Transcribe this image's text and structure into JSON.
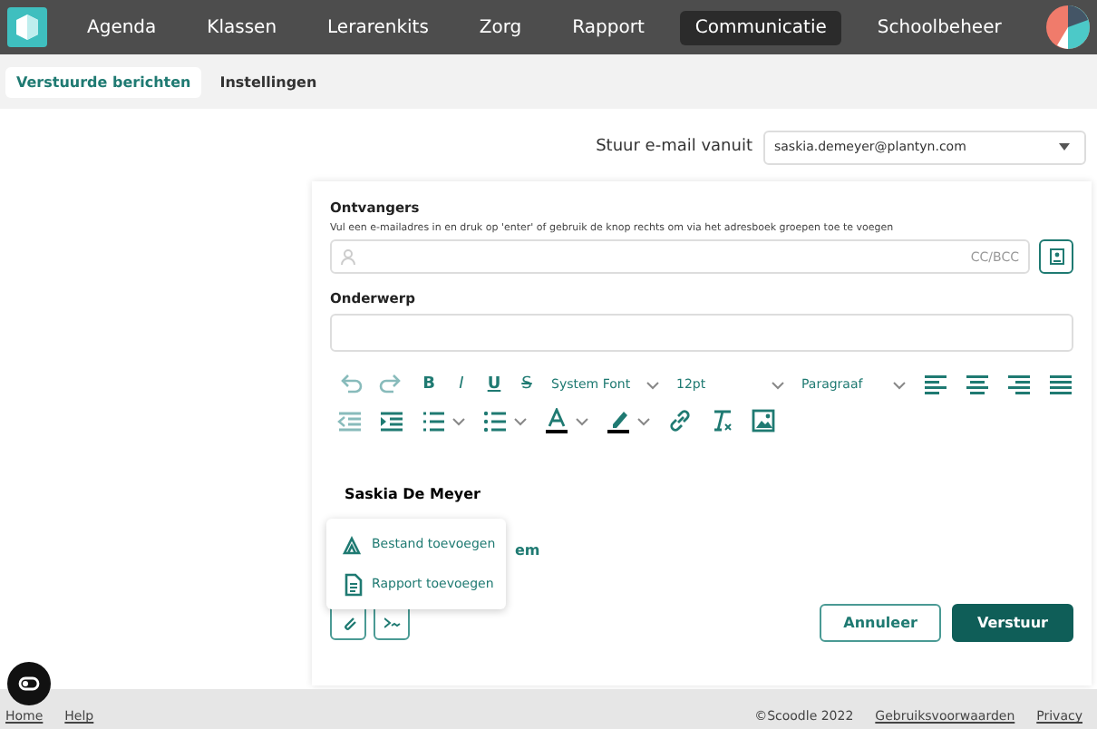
{
  "nav": [
    {
      "label": "Agenda",
      "selected": false
    },
    {
      "label": "Klassen",
      "selected": false
    },
    {
      "label": "Lerarenkits",
      "selected": false
    },
    {
      "label": "Zorg",
      "selected": false
    },
    {
      "label": "Rapport",
      "selected": false
    },
    {
      "label": "Communicatie",
      "selected": true
    },
    {
      "label": "Schoolbeheer",
      "selected": false
    }
  ],
  "subtabs": [
    {
      "label": "Verstuurde berichten",
      "selected": true
    },
    {
      "label": "Instellingen",
      "selected": false
    }
  ],
  "sender": {
    "label": "Stuur e-mail vanuit",
    "value": "saskia.demeyer@plantyn.com"
  },
  "recipients": {
    "label": "Ontvangers",
    "hint": "Vul een e-mailadres in en druk op 'enter' of gebruik de knop rechts om via het adresboek groepen toe te voegen",
    "cc": "CC/BCC"
  },
  "subject": {
    "label": "Onderwerp"
  },
  "toolbar": {
    "format": [
      {
        "kind": "bold",
        "glyph": "B"
      },
      {
        "kind": "italic",
        "glyph": "I"
      },
      {
        "kind": "underline",
        "glyph": "U"
      },
      {
        "kind": "strike",
        "glyph": "S"
      }
    ],
    "font": "System Font",
    "size": "12pt",
    "block": "Paragraaf"
  },
  "body": {
    "signature": "Saskia De Meyer",
    "partial": "em"
  },
  "attach_menu": [
    {
      "kind": "file",
      "label": "Bestand toevoegen"
    },
    {
      "kind": "report",
      "label": "Rapport toevoegen"
    }
  ],
  "buttons": {
    "cancel": "Annuleer",
    "send": "Verstuur"
  },
  "footer": {
    "left_links": [
      "Home",
      "Help"
    ],
    "copyright": "©Scoodle 2022",
    "links": [
      "Gebruiksvoorwaarden",
      "Privacy"
    ]
  }
}
